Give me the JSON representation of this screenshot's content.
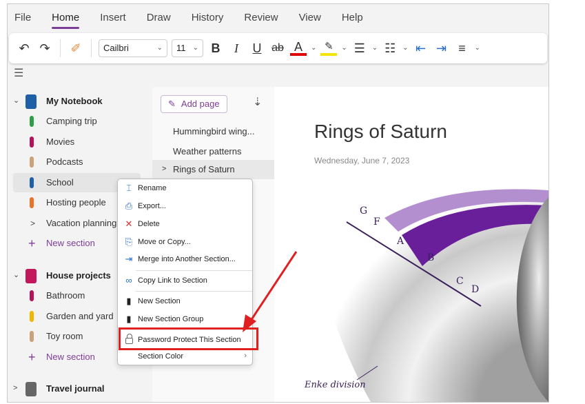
{
  "menu_tabs": [
    "File",
    "Home",
    "Insert",
    "Draw",
    "History",
    "Review",
    "View",
    "Help"
  ],
  "active_tab": "Home",
  "toolbar": {
    "font": "Cailbri",
    "size": "11",
    "bold": "B",
    "italic": "I",
    "underline": "U",
    "strike": "ab",
    "font_color": "A",
    "font_color_hex": "#e00000",
    "highlight_hex": "#f5e400"
  },
  "notebooks": [
    {
      "name": "My Notebook",
      "color": "#1e5fa8",
      "sections": [
        {
          "name": "Camping trip",
          "color": "#2e9e4a"
        },
        {
          "name": "Movies",
          "color": "#b4135a"
        },
        {
          "name": "Podcasts",
          "color": "#c9a27a"
        },
        {
          "name": "School",
          "color": "#1e5fa8"
        },
        {
          "name": "Hosting people",
          "color": "#e8742a"
        },
        {
          "name": "Vacation planning",
          "group": true
        }
      ],
      "new_section": "New section"
    },
    {
      "name": "House projects",
      "color": "#c2185b",
      "sections": [
        {
          "name": "Bathroom",
          "color": "#b4135a"
        },
        {
          "name": "Garden and yard",
          "color": "#f2b600"
        },
        {
          "name": "Toy room",
          "color": "#c9a27a"
        }
      ],
      "new_section": "New section"
    },
    {
      "name": "Travel journal",
      "color": "#666"
    }
  ],
  "pages": {
    "add_page": "Add page",
    "items": [
      "Hummingbird wing...",
      "Weather patterns",
      "Rings of Saturn"
    ]
  },
  "page": {
    "title": "Rings of Saturn",
    "date": "Wednesday, June 7, 2023",
    "ring_labels": [
      "G",
      "F",
      "A",
      "B",
      "C",
      "D"
    ],
    "annotation": "Enke division"
  },
  "context_menu": [
    "Rename",
    "Export...",
    "Delete",
    "Move or Copy...",
    "Merge into Another Section...",
    "Copy Link to Section",
    "New Section",
    "New Section Group",
    "Password Protect This Section",
    "Section Color"
  ]
}
